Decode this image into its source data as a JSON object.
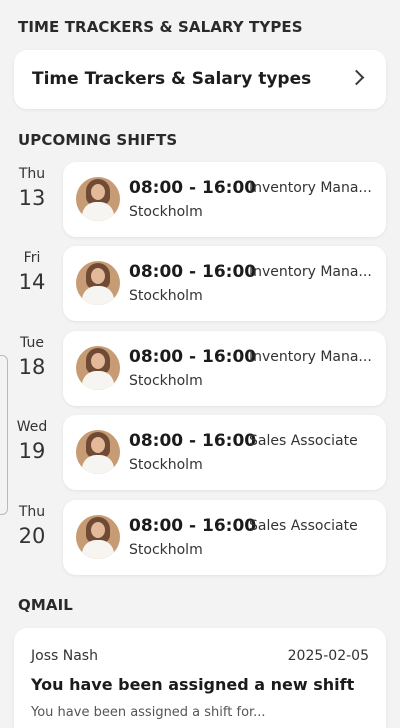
{
  "sections": {
    "trackers_title": "TIME TRACKERS & SALARY TYPES",
    "shifts_title": "UPCOMING SHIFTS",
    "qmail_title": "QMAIL"
  },
  "tracker_card": {
    "label": "Time Trackers & Salary types",
    "icon": "chevron-right-icon"
  },
  "shifts": [
    {
      "day": "Thu",
      "date": "13",
      "time": "08:00 - 16:00",
      "role": "Inventory Mana...",
      "location": "Stockholm"
    },
    {
      "day": "Fri",
      "date": "14",
      "time": "08:00 - 16:00",
      "role": "Inventory Mana...",
      "location": "Stockholm"
    },
    {
      "day": "Tue",
      "date": "18",
      "time": "08:00 - 16:00",
      "role": "Inventory Mana...",
      "location": "Stockholm"
    },
    {
      "day": "Wed",
      "date": "19",
      "time": "08:00 - 16:00",
      "role": "Sales Associate",
      "location": "Stockholm"
    },
    {
      "day": "Thu",
      "date": "20",
      "time": "08:00 - 16:00",
      "role": "Sales Associate",
      "location": "Stockholm"
    }
  ],
  "qmail": {
    "sender": "Joss Nash",
    "date": "2025-02-05",
    "subject": "You have been assigned a new shift",
    "preview": "You have been assigned a shift for..."
  },
  "colors": {
    "background": "#f3f3f4",
    "card": "#ffffff",
    "text": "#1f1f1f",
    "avatar_bg": "#c79b73"
  }
}
